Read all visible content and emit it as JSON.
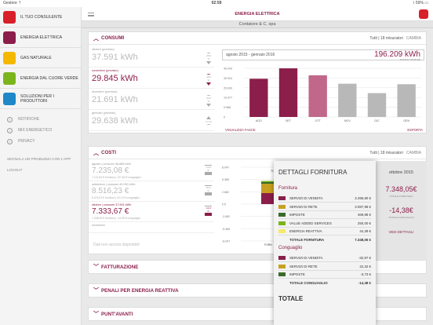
{
  "statusbar": {
    "carrier": "Gestore ⇡",
    "time": "02:59",
    "battery": "⌇ 59% ▭"
  },
  "sidebar": {
    "items": [
      {
        "label": "IL TUO CONSULENTE",
        "color": "#d8202a"
      },
      {
        "label": "ENERGIA ELETTRICA",
        "color": "#8b1e4a"
      },
      {
        "label": "GAS NATURALE",
        "color": "#f5b800"
      },
      {
        "label": "ENERGIA DAL CUORE VERDE",
        "color": "#7ab51d"
      },
      {
        "label": "SOLUZIONI PER I PRODUTTORI",
        "color": "#1e88c8"
      }
    ],
    "sub_items": [
      "NOTIFICHE",
      "MIX ENERGETICO",
      "PRIVACY"
    ],
    "links": [
      "SEGNALA UN PROBLEMA CON L'APP",
      "LOGOUT"
    ]
  },
  "header": {
    "title": "ENERGIA ELETTRICA",
    "subtitle": "Contatore & C. spa"
  },
  "consumi": {
    "title": "CONSUMI",
    "filter": "Tutti | 18 misuratori",
    "change": "CAMBIA",
    "rows": [
      {
        "label": "ottobre (previsto)",
        "value": "37.591 kWh",
        "pct": "25,9 %",
        "dir": "down",
        "sel": false
      },
      {
        "label": "novembre (previsto)",
        "value": "29.845 kWh",
        "pct": "-18,1 %",
        "dir": "down",
        "sel": true
      },
      {
        "label": "dicembre (previsto)",
        "value": "21.691 kWh",
        "pct": "21,5 %",
        "dir": "down",
        "sel": false
      },
      {
        "label": "gennaio (previsto)",
        "value": "29.638 kWh",
        "pct": "3,7 %",
        "dir": "up",
        "sel": false
      }
    ],
    "chart": {
      "period": "agosto 2015 - gennaio 2016",
      "total": "196.209 kWh",
      "total_label": "TOTALE CONSUMI",
      "link_left": "VISUALIZZA FASCE",
      "link_right": "ESPORTA"
    }
  },
  "chart_data": {
    "type": "bar",
    "categories": [
      "AGO",
      "SET",
      "OTT",
      "NOV",
      "DIC",
      "GEN"
    ],
    "values": [
      38500,
      49000,
      42000,
      33500,
      24000,
      33000
    ],
    "colors": [
      "#8b1e4a",
      "#8b1e4a",
      "#c0678a",
      "#b8b8b8",
      "#b8b8b8",
      "#b8b8b8"
    ],
    "yticks": [
      "49.043",
      "39.924",
      "29.943",
      "19.977",
      "9.988",
      "0"
    ],
    "ylim": [
      0,
      49043
    ]
  },
  "costi": {
    "title": "COSTI",
    "filter": "Tutti | 18 misuratori",
    "change": "CAMBIA",
    "rows": [
      {
        "label": "agosto | consumi 38.885 kWh",
        "value": "7.235,08 €",
        "detail": "7.121,84 € fornitura | 137,84 € conguaglio",
        "pct": "-12,6 %",
        "sel": false
      },
      {
        "label": "settembre | consumi 49.090 kWh",
        "value": "8.516,23 €",
        "detail": "8.478,23 € fornitura | 42,13 € conguaglio",
        "pct": "16,4 %",
        "sel": false
      },
      {
        "label": "ottobre | consumi 37.591 kWh",
        "value": "7.333,67 €",
        "detail": "7.348,05 € fornitura | -14,38 € conguaglio",
        "pct": "-14,0 %",
        "sel": true
      },
      {
        "label": "novembre",
        "value": "",
        "detail": "",
        "pct": "",
        "sel": false
      }
    ],
    "no_data": "Dati non ancora disponibili",
    "yticks": [
      "8.047",
      "5.365",
      "2.682",
      "0 €",
      "-2.682",
      "-5.365",
      "-8.047"
    ],
    "forn_label": "TOT",
    "forn2": "FORN"
  },
  "collapsed": [
    "FATTURAZIONE",
    "PENALI PER ENERGIA REATTIVA",
    "PUNT'AVANTI"
  ],
  "overlay": {
    "title": "DETTAGLI FORNITURA",
    "sec1": "Fornitura",
    "forn": [
      {
        "name": "SERVIZI DI VENDITA",
        "amount": "3.495,80 €",
        "color": "#8b1e4a"
      },
      {
        "name": "SERVIZI DI RETE",
        "amount": "3.087,98 €",
        "color": "#c8a021"
      },
      {
        "name": "IMPOSTE",
        "amount": "469,88 €",
        "color": "#3a6b2a"
      },
      {
        "name": "VALUE ADDED SERVICES",
        "amount": "250,00 €",
        "color": "#7ab51d"
      },
      {
        "name": "ENERGIA REATTIVA",
        "amount": "44,39 €",
        "color": "#f6e96b"
      }
    ],
    "forn_total": {
      "name": "TOTALE FORNITURA",
      "amount": "7.348,05 €"
    },
    "sec2": "Conguaglio",
    "cong": [
      {
        "name": "SERVIZI DI VENDITA",
        "amount": "-32,97 €",
        "color": "#8b1e4a"
      },
      {
        "name": "SERVIZI DI RETE",
        "amount": "22,32 €",
        "color": "#c8a021"
      },
      {
        "name": "IMPOSTE",
        "amount": "-3,73 €",
        "color": "#3a6b2a"
      }
    ],
    "cong_total": {
      "name": "TOTALE CONGUAGLIO",
      "amount": "-14,38 €"
    },
    "total": "TOTALE"
  },
  "right_panel": {
    "period": "ottobre 2015",
    "v1": "7.348,05€",
    "l1": "TOTALE FORNITURA",
    "v2": "-14,38€",
    "l2": "TOTALE CONGUAGLIO",
    "button": "VEDI DETTAGLI"
  }
}
